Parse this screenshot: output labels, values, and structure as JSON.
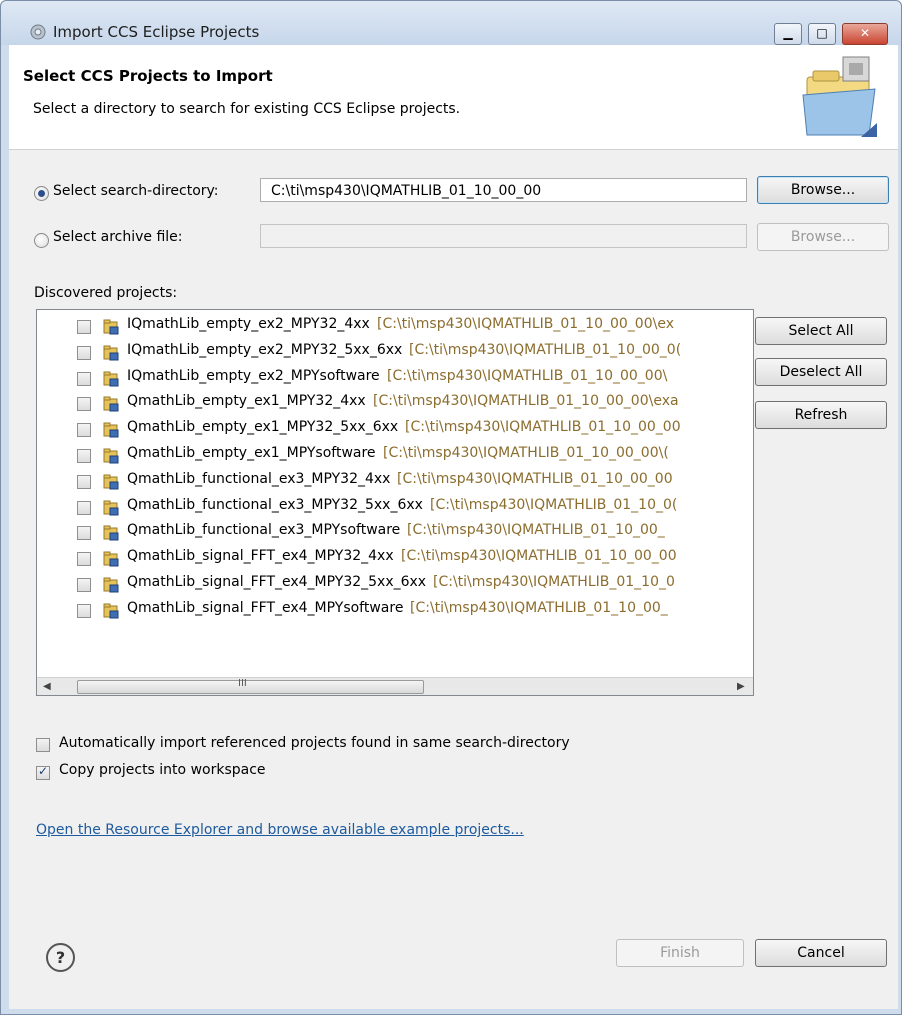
{
  "window": {
    "title": "Import CCS Eclipse Projects",
    "min_symbol": "▁",
    "max_symbol": "□",
    "close_symbol": "✕"
  },
  "banner": {
    "heading": "Select CCS Projects to Import",
    "description": "Select a directory to search for existing CCS Eclipse projects."
  },
  "source": {
    "search_dir_label": "Select search-directory:",
    "search_dir_value": "C:\\ti\\msp430\\IQMATHLIB_01_10_00_00",
    "archive_label": "Select archive file:",
    "archive_value": "",
    "browse_label": "Browse...",
    "browse_disabled_label": "Browse...",
    "selected": "search-directory"
  },
  "discovered": {
    "label": "Discovered projects:",
    "projects": [
      {
        "name": "IQmathLib_empty_ex2_MPY32_4xx",
        "path": "[C:\\ti\\msp430\\IQMATHLIB_01_10_00_00\\ex",
        "checked": false
      },
      {
        "name": "IQmathLib_empty_ex2_MPY32_5xx_6xx",
        "path": "[C:\\ti\\msp430\\IQMATHLIB_01_10_00_0(",
        "checked": false
      },
      {
        "name": "IQmathLib_empty_ex2_MPYsoftware",
        "path": "[C:\\ti\\msp430\\IQMATHLIB_01_10_00_00\\",
        "checked": false
      },
      {
        "name": "QmathLib_empty_ex1_MPY32_4xx",
        "path": "[C:\\ti\\msp430\\IQMATHLIB_01_10_00_00\\exa",
        "checked": false
      },
      {
        "name": "QmathLib_empty_ex1_MPY32_5xx_6xx",
        "path": "[C:\\ti\\msp430\\IQMATHLIB_01_10_00_00",
        "checked": false
      },
      {
        "name": "QmathLib_empty_ex1_MPYsoftware",
        "path": "[C:\\ti\\msp430\\IQMATHLIB_01_10_00_00\\(",
        "checked": false
      },
      {
        "name": "QmathLib_functional_ex3_MPY32_4xx",
        "path": "[C:\\ti\\msp430\\IQMATHLIB_01_10_00_00",
        "checked": false
      },
      {
        "name": "QmathLib_functional_ex3_MPY32_5xx_6xx",
        "path": "[C:\\ti\\msp430\\IQMATHLIB_01_10_0(",
        "checked": false
      },
      {
        "name": "QmathLib_functional_ex3_MPYsoftware",
        "path": "[C:\\ti\\msp430\\IQMATHLIB_01_10_00_",
        "checked": false
      },
      {
        "name": "QmathLib_signal_FFT_ex4_MPY32_4xx",
        "path": "[C:\\ti\\msp430\\IQMATHLIB_01_10_00_00",
        "checked": false
      },
      {
        "name": "QmathLib_signal_FFT_ex4_MPY32_5xx_6xx",
        "path": "[C:\\ti\\msp430\\IQMATHLIB_01_10_0",
        "checked": false
      },
      {
        "name": "QmathLib_signal_FFT_ex4_MPYsoftware",
        "path": "[C:\\ti\\msp430\\IQMATHLIB_01_10_00_",
        "checked": false
      }
    ],
    "select_all": "Select All",
    "deselect_all": "Deselect All",
    "refresh": "Refresh",
    "scroll_left": "◀",
    "scroll_right": "▶",
    "scroll_grip": "III"
  },
  "options": {
    "auto_import_label": "Automatically import referenced projects found in same search-directory",
    "auto_import_checked": false,
    "copy_label": "Copy projects into workspace",
    "copy_checked": true
  },
  "resource_link": "Open the Resource Explorer and browse available example projects...",
  "footer": {
    "help": "?",
    "finish": "Finish",
    "cancel": "Cancel"
  }
}
